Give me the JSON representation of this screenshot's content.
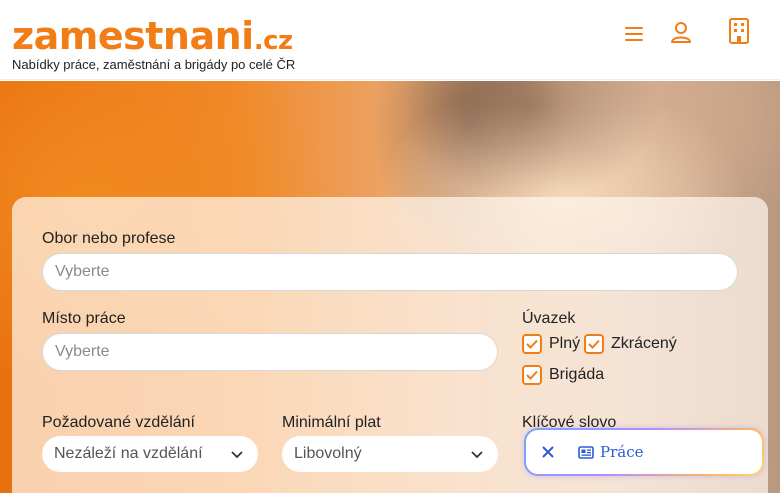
{
  "header": {
    "logo_main": "zamestnani",
    "logo_tld": ".cz",
    "tagline": "Nabídky práce, zaměstnání a brigády po celé ČR"
  },
  "icons": {
    "menu": "hamburger-menu-icon",
    "user": "user-icon",
    "company": "building-icon"
  },
  "colors": {
    "brand": "#f07d16",
    "chip_text": "#2a5bd7"
  },
  "search": {
    "field_label": "Obor nebo profese",
    "field_placeholder": "Vyberte",
    "location_label": "Místo práce",
    "location_placeholder": "Vyberte",
    "workload_label": "Úvazek",
    "workload_options": [
      {
        "label": "Plný",
        "checked": true
      },
      {
        "label": "Zkrácený",
        "checked": true
      },
      {
        "label": "Brigáda",
        "checked": true
      }
    ],
    "education_label": "Požadované vzdělání",
    "education_value": "Nezáleží na vzdělání",
    "salary_label": "Minimální plat",
    "salary_value": "Libovolný",
    "keyword_label": "Klíčové slovo",
    "keyword_chip": "Práce"
  }
}
